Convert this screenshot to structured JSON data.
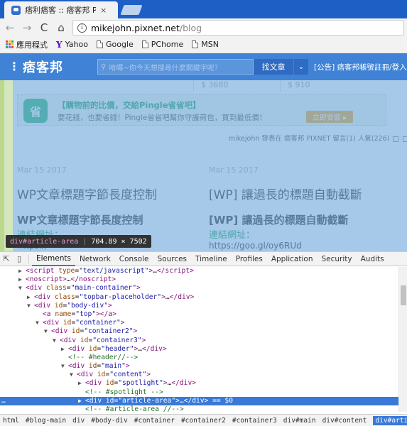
{
  "browser": {
    "tab_title": "痞利痞客 :: 痞客邦 PIXNET",
    "tab_close": "×",
    "url_host": "mikejohn.pixnet.net",
    "url_path": "/blog",
    "back": "←",
    "forward": "→",
    "reload": "C",
    "home": "⌂",
    "info": "i"
  },
  "bookmarks": [
    {
      "label": "應用程式",
      "icon": "apps-icon"
    },
    {
      "label": "Yahoo",
      "icon": "yahoo-icon"
    },
    {
      "label": "Google",
      "icon": "doc-icon"
    },
    {
      "label": "PChome",
      "icon": "doc-icon"
    },
    {
      "label": "MSN",
      "icon": "doc-icon"
    }
  ],
  "site": {
    "logo": "痞客邦",
    "search_placeholder": "哈囉~你今天想搜尋什麼關鍵字呢？",
    "search_button": "找文章",
    "search_dropdown": "⌄",
    "announcement": "[公告] 痞客邦帳號註冊/登入",
    "prices": [
      "$ 3680",
      "$ 910"
    ],
    "ad": {
      "icon_text": "省",
      "title": "【購物前的比價，交給Pingle省省吧】",
      "text": "要花錢，也要省錢！Pingle省省吧幫你守護荷包，買到最低價！",
      "button": "立即安裝 ▸"
    },
    "meta": "mikejohn 發表在 痞客邦 PIXNET 留言(1) 人氣(226)",
    "posts": [
      {
        "date": "Mar 15 2017",
        "title": "WP文章標題字節長度控制",
        "subtitle": "WP文章標題字節長度控制",
        "link_label": "連結網址：",
        "link": "https://"
      },
      {
        "date": "Mar 15 2017",
        "title": "[WP] 讓過長的標題自動截斷",
        "subtitle": "[WP] 讓過長的標題自動截斷",
        "link_label": "連結網址：",
        "link": "https://goo.gl/oy6RUd"
      }
    ],
    "tooltip_tag": "div#article-area",
    "tooltip_sep": "|",
    "tooltip_size": "704.89 × 7502"
  },
  "devtools": {
    "tabs": [
      "Elements",
      "Network",
      "Console",
      "Sources",
      "Timeline",
      "Profiles",
      "Application",
      "Security",
      "Audits"
    ],
    "active_tab": "Elements",
    "dom_lines": [
      {
        "indent": 1,
        "arrow": "▶",
        "html": "<span class='t'>&lt;script</span> <span class='a'>type</span>=<span class='v'>\"text/javascript\"</span><span class='t'>&gt;</span>…<span class='t'>&lt;/script&gt;</span>"
      },
      {
        "indent": 1,
        "arrow": "▶",
        "html": "<span class='t'>&lt;noscript&gt;</span>…<span class='t'>&lt;/noscript&gt;</span>"
      },
      {
        "indent": 1,
        "arrow": "▼",
        "html": "<span class='t'>&lt;div</span> <span class='a'>class</span>=<span class='v'>\"main-container\"</span><span class='t'>&gt;</span>"
      },
      {
        "indent": 2,
        "arrow": "▶",
        "html": "<span class='t'>&lt;div</span> <span class='a'>class</span>=<span class='v'>\"topbar-placeholder\"</span><span class='t'>&gt;</span>…<span class='t'>&lt;/div&gt;</span>"
      },
      {
        "indent": 2,
        "arrow": "▼",
        "html": "<span class='t'>&lt;div</span> <span class='a'>id</span>=<span class='v'>\"body-div\"</span><span class='t'>&gt;</span>"
      },
      {
        "indent": 3,
        "arrow": "",
        "html": "<span class='t'>&lt;a</span> <span class='a'>name</span>=<span class='v'>\"top\"</span><span class='t'>&gt;&lt;/a&gt;</span>"
      },
      {
        "indent": 3,
        "arrow": "▼",
        "html": "<span class='t'>&lt;div</span> <span class='a'>id</span>=<span class='v'>\"container\"</span><span class='t'>&gt;</span>"
      },
      {
        "indent": 4,
        "arrow": "▼",
        "html": "<span class='t'>&lt;div</span> <span class='a'>id</span>=<span class='v'>\"container2\"</span><span class='t'>&gt;</span>"
      },
      {
        "indent": 5,
        "arrow": "▼",
        "html": "<span class='t'>&lt;div</span> <span class='a'>id</span>=<span class='v'>\"container3\"</span><span class='t'>&gt;</span>"
      },
      {
        "indent": 6,
        "arrow": "▶",
        "html": "<span class='t'>&lt;div</span> <span class='a'>id</span>=<span class='v'>\"header\"</span><span class='t'>&gt;</span>…<span class='t'>&lt;/div&gt;</span>"
      },
      {
        "indent": 6,
        "arrow": "",
        "html": "<span class='c'>&lt;!-- #header//--&gt;</span>"
      },
      {
        "indent": 6,
        "arrow": "▼",
        "html": "<span class='t'>&lt;div</span> <span class='a'>id</span>=<span class='v'>\"main\"</span><span class='t'>&gt;</span>"
      },
      {
        "indent": 7,
        "arrow": "▼",
        "html": "<span class='t'>&lt;div</span> <span class='a'>id</span>=<span class='v'>\"content\"</span><span class='t'>&gt;</span>"
      },
      {
        "indent": 8,
        "arrow": "▶",
        "html": "<span class='t'>&lt;div</span> <span class='a'>id</span>=<span class='v'>\"spotlight\"</span><span class='t'>&gt;</span>…<span class='t'>&lt;/div&gt;</span>"
      },
      {
        "indent": 8,
        "arrow": "",
        "html": "<span class='c'>&lt;!-- #spotlight --&gt;</span>"
      },
      {
        "indent": 8,
        "arrow": "▶",
        "selected": true,
        "html": "<span class='t'>&lt;div</span> <span class='a'>id</span>=<span class='v'>\"article-area\"</span><span class='t'>&gt;</span>…<span class='t'>&lt;/div&gt;</span> == $0"
      },
      {
        "indent": 8,
        "arrow": "",
        "html": "<span class='c'>&lt;!-- #article-area //--&gt;</span>"
      }
    ],
    "breadcrumbs": [
      "html",
      "#blog-main",
      "div",
      "#body-div",
      "#container",
      "#container2",
      "#container3",
      "div#main",
      "div#content",
      "div#article-area"
    ],
    "active_breadcrumb": "div#article-area"
  }
}
